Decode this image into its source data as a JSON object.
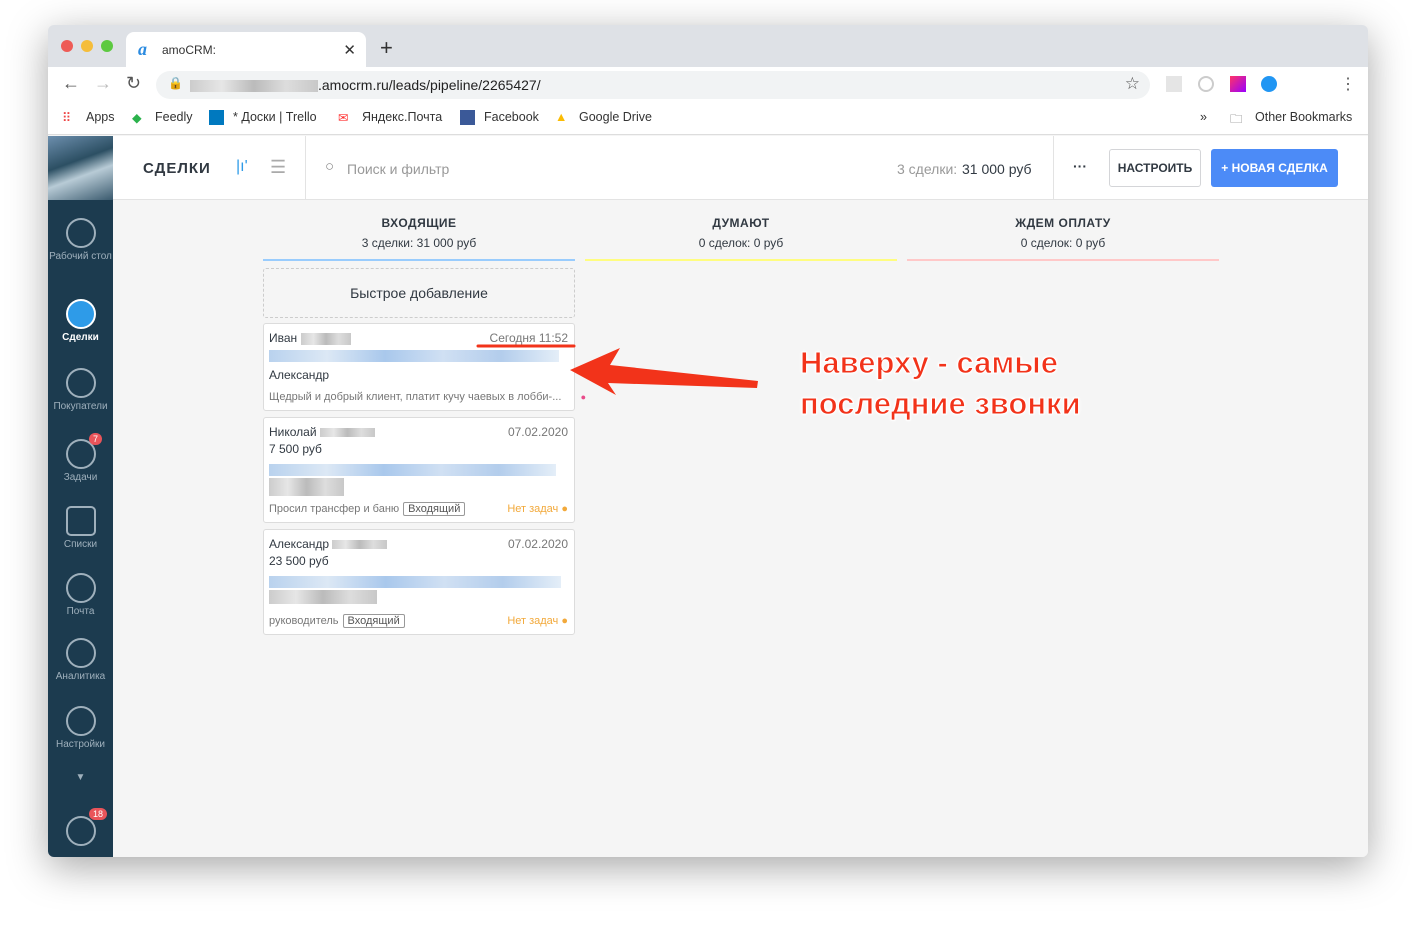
{
  "browser": {
    "tab_title": "amoCRM:",
    "url": ".amocrm.ru/leads/pipeline/2265427/",
    "bookmarks": [
      "Apps",
      "Feedly",
      "* Доски | Trello",
      "Яндекс.Почта",
      "Facebook",
      "Google Drive"
    ],
    "other_bookmarks": "Other Bookmarks",
    "overflow": "»"
  },
  "sidebar": {
    "items": [
      {
        "label": "Рабочий стол",
        "icon": "dashboard-icon"
      },
      {
        "label": "Сделки",
        "icon": "deals-icon",
        "active": true
      },
      {
        "label": "Покупатели",
        "icon": "customers-icon"
      },
      {
        "label": "Задачи",
        "icon": "tasks-icon",
        "badge": "7"
      },
      {
        "label": "Списки",
        "icon": "lists-icon"
      },
      {
        "label": "Почта",
        "icon": "mail-icon"
      },
      {
        "label": "Аналитика",
        "icon": "analytics-icon"
      },
      {
        "label": "Настройки",
        "icon": "settings-icon"
      }
    ],
    "chat_badge": "18"
  },
  "header": {
    "title": "СДЕЛКИ",
    "search_placeholder": "Поиск и фильтр",
    "summary_label": "3 сделки:",
    "summary_value": "31 000 руб",
    "more": "···",
    "configure": "НАСТРОИТЬ",
    "new_deal": "+ НОВАЯ СДЕЛКА"
  },
  "columns": [
    {
      "title": "ВХОДЯЩИЕ",
      "summary": "3 сделки: 31 000 руб",
      "color": "#99ccfd"
    },
    {
      "title": "ДУМАЮТ",
      "summary": "0 сделок: 0 руб",
      "color": "#fffd7f"
    },
    {
      "title": "ЖДЕМ ОПЛАТУ",
      "summary": "0 сделок: 0 руб",
      "color": "#ffc8c8"
    }
  ],
  "quick_add": "Быстрое добавление",
  "cards": [
    {
      "name": "Иван",
      "date": "Сегодня 11:52",
      "contact": "Александр",
      "note": "Щедрый и добрый клиент, платит кучу чаевых в лобби-..."
    },
    {
      "name": "Николай",
      "date": "07.02.2020",
      "price": "7 500 руб",
      "note": "Просил трансфер и баню",
      "tag": "Входящий",
      "tasks": "Нет задач"
    },
    {
      "name": "Александр",
      "date": "07.02.2020",
      "price": "23 500 руб",
      "note": "руководитель",
      "tag": "Входящий",
      "tasks": "Нет задач"
    }
  ],
  "annotation": {
    "line1": "Наверху - самые",
    "line2": "последние звонки",
    "color": "#f2331a"
  }
}
